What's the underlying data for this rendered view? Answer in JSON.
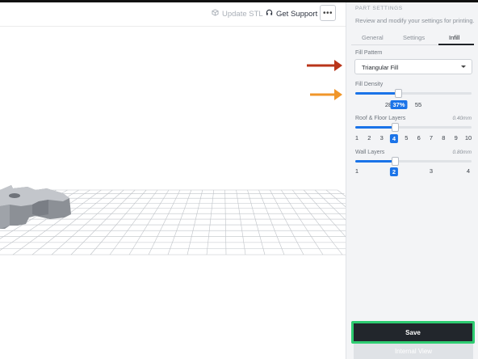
{
  "toolbar": {
    "update_label": "Update STL",
    "support_label": "Get Support",
    "more_label": "•••"
  },
  "sidebar": {
    "title": "PART SETTINGS",
    "subtitle": "Review and modify your settings for printing.",
    "tabs": [
      {
        "label": "General",
        "active": false
      },
      {
        "label": "Settings",
        "active": false
      },
      {
        "label": "Infill",
        "active": true
      }
    ],
    "fill_pattern": {
      "label": "Fill Pattern",
      "value": "Triangular Fill"
    },
    "fill_density": {
      "label": "Fill Density",
      "min": "28",
      "current": "37%",
      "max": "55",
      "fraction": 0.37
    },
    "roof_floor": {
      "label": "Roof & Floor Layers",
      "unit": "0.40mm",
      "ticks": [
        "1",
        "2",
        "3",
        "4",
        "5",
        "6",
        "7",
        "8",
        "9",
        "10"
      ],
      "selected": "4"
    },
    "wall_layers": {
      "label": "Wall Layers",
      "unit": "0.80mm",
      "ticks": [
        "1",
        "2",
        "3",
        "4"
      ],
      "selected": "2"
    }
  },
  "actions": {
    "save_label": "Save",
    "internal_view_label": "Internal View"
  },
  "colors": {
    "accent": "#1a73e8",
    "highlight_box": "#2ecc71",
    "arrow_red": "#b9351a",
    "arrow_orange": "#f0962a",
    "save_bg": "#22262c"
  }
}
